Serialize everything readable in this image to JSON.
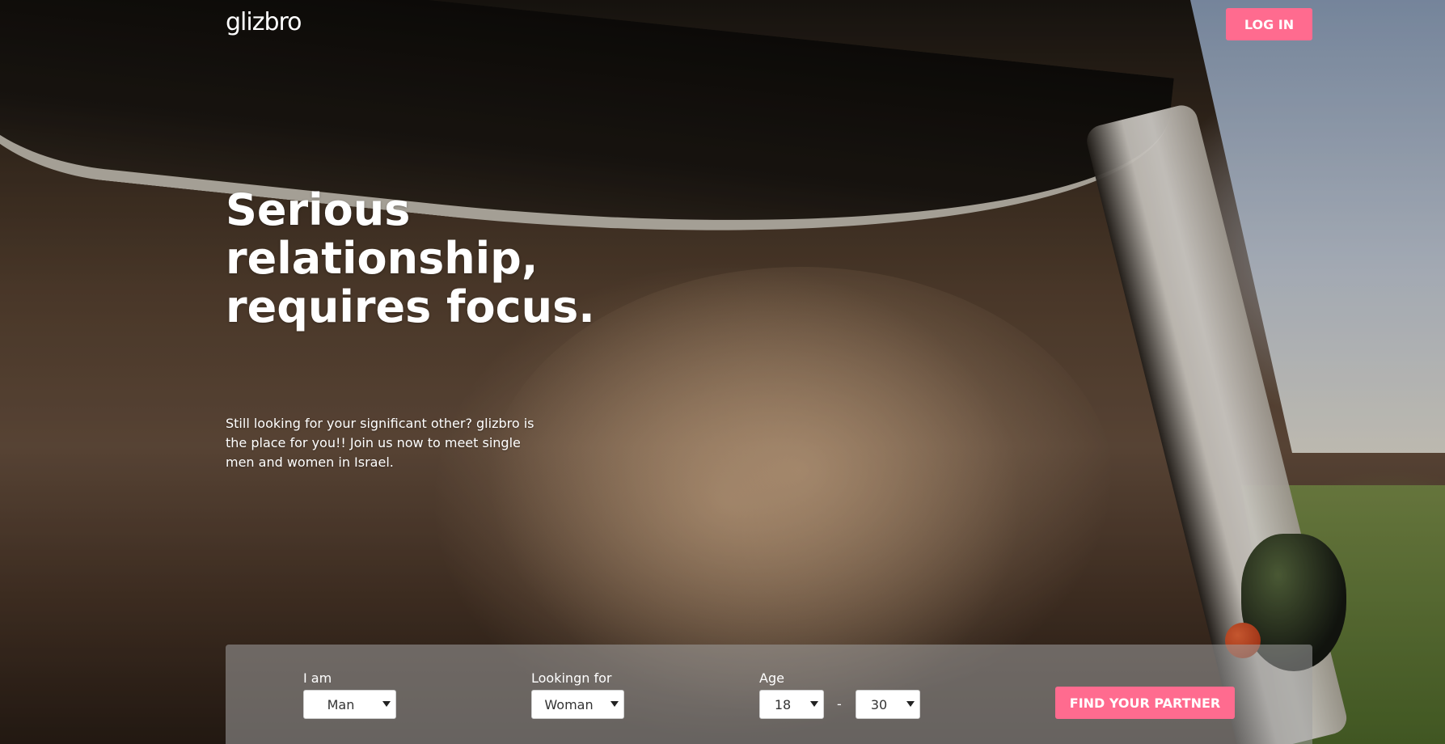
{
  "header": {
    "logo": "glizbro",
    "login_label": "LOG IN"
  },
  "hero": {
    "headline": "Serious relationship, requires focus.",
    "subtext": "Still looking for your significant other? glizbro is the place for you!! Join us now to meet single men and women in Israel."
  },
  "search": {
    "i_am_label": "I am",
    "i_am_value": "Man",
    "looking_for_label": "Lookingn for",
    "looking_for_value": "Woman",
    "age_label": "Age",
    "age_min": "18",
    "age_separator": "-",
    "age_max": "30",
    "find_label": "FIND YOUR PARTNER"
  },
  "colors": {
    "accent": "#ff6b8f",
    "panel": "#a0a0a0",
    "text_light": "#ffffff"
  }
}
